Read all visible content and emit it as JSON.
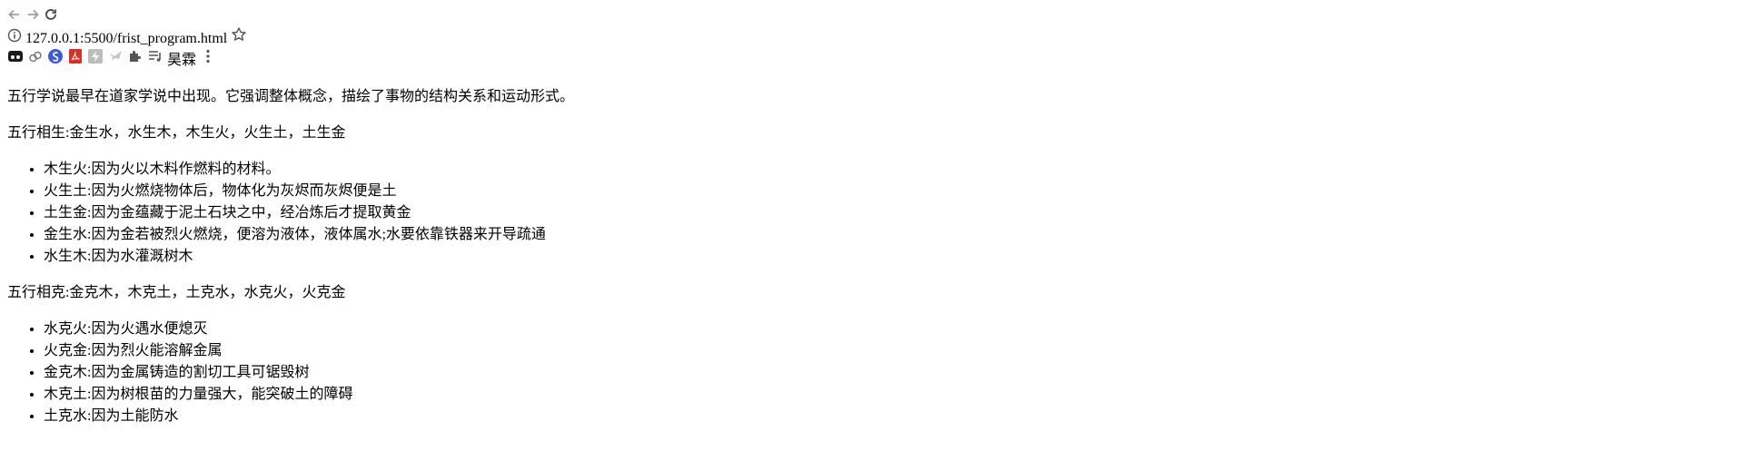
{
  "browser": {
    "url_host": "127.0.0.1",
    "url_rest": ":5500/frist_program.html",
    "profile": "昊霖"
  },
  "content": {
    "intro": "五行学说最早在道家学说中出现。它强调整体概念，描绘了事物的结构关系和运动形式。",
    "sheng": {
      "heading": [
        "五行相生:金生水，水生",
        "木",
        "，",
        "木",
        "生火，火生土，土生金"
      ],
      "items": [
        [
          "木生火:因为火以木料作燃料的材料。"
        ],
        [
          "火生土:因为火燃烧物体后，物体化为灰烬而灰烬便是土"
        ],
        [
          "土生金:因为金蕴藏于泥土石块之中，经冶炼后才提取黄金"
        ],
        [
          "金生水:因为金若被烈火燃烧，便溶为液体，液体属水;水要依靠铁器来开导疏通"
        ],
        [
          "水生木:因为水灌溉树",
          "木"
        ]
      ]
    },
    "ke": {
      "heading": [
        "五行相克:金克",
        "木",
        "，",
        "木",
        "克土，土克水，水克火，火克金"
      ],
      "items": [
        [
          "水克火:因为火遇水便熄灭"
        ],
        [
          "火克金:因为烈火能溶解金属"
        ],
        [
          "金克",
          "木",
          ":因为金属铸造的割切工具可锯毁树"
        ],
        [
          "木克土:因为树根苗的力量强大，能突破土的障碍"
        ],
        [
          "土克水:因为土能防水"
        ]
      ]
    }
  }
}
